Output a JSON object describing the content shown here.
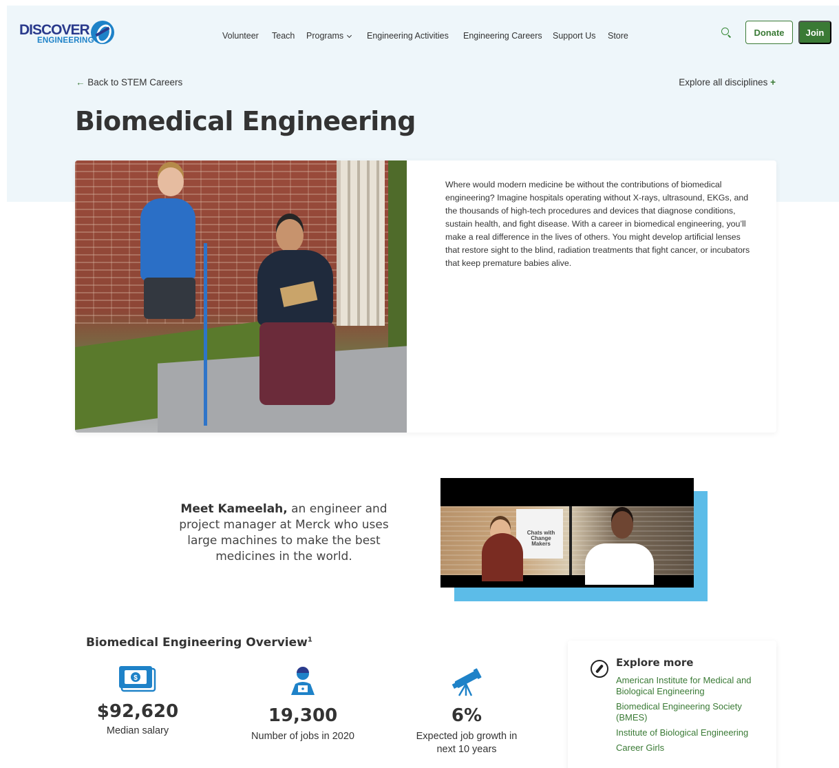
{
  "header": {
    "logo_top": "DISCOVER",
    "logo_bottom": "ENGINEERING",
    "nav": [
      {
        "label": "Volunteer"
      },
      {
        "label": "Teach"
      },
      {
        "label": "Programs"
      },
      {
        "label": "Engineering Activities"
      },
      {
        "label": "Engineering Careers"
      },
      {
        "label": "Support Us"
      },
      {
        "label": "Store"
      }
    ],
    "donate_label": "Donate",
    "join_label": "Join"
  },
  "breadcrumb": {
    "back_label": "Back to STEM Careers",
    "explore_label": "Explore all disciplines"
  },
  "page_title": "Biomedical Engineering",
  "intro_text": "Where would modern medicine be without the contributions of biomedical engineering? Imagine hospitals operating without X-rays, ultrasound, EKGs, and the thousands of high-tech procedures and devices that diagnose conditions, sustain health, and fight disease. With a career in biomedical engineering, you’ll make a real difference in the lives of others. You might develop artificial lenses that restore sight to the blind, radiation treatments that fight cancer, or incubators that keep premature babies alive.",
  "meet": {
    "name": "Meet Kameelah,",
    "rest": " an engineer and project manager at Merck who uses large machines to make the best medicines in the world."
  },
  "video": {
    "poster_text": "Chats with Change Makers"
  },
  "overview": {
    "title": "Biomedical Engineering Overview",
    "footnote": "1",
    "stats": [
      {
        "icon": "money-icon",
        "value": "$92,620",
        "label": "Median salary"
      },
      {
        "icon": "worker-icon",
        "value": "19,300",
        "label": "Number of jobs in 2020"
      },
      {
        "icon": "telescope-icon",
        "value": "6%",
        "label": "Expected job growth in next 10 years"
      }
    ]
  },
  "explore_more": {
    "title": "Explore more",
    "links": [
      "American Institute for Medical and Biological Engineering",
      "Biomedical Engineering Society (BMES)",
      "Institute of Biological Engineering",
      "Career Girls"
    ]
  },
  "colors": {
    "brand_green": "#3a7a35",
    "brand_blue": "#1e82c8",
    "brand_navy": "#2a3a8c",
    "hero_bg": "#eef6fa",
    "video_accent": "#5cbce8"
  }
}
